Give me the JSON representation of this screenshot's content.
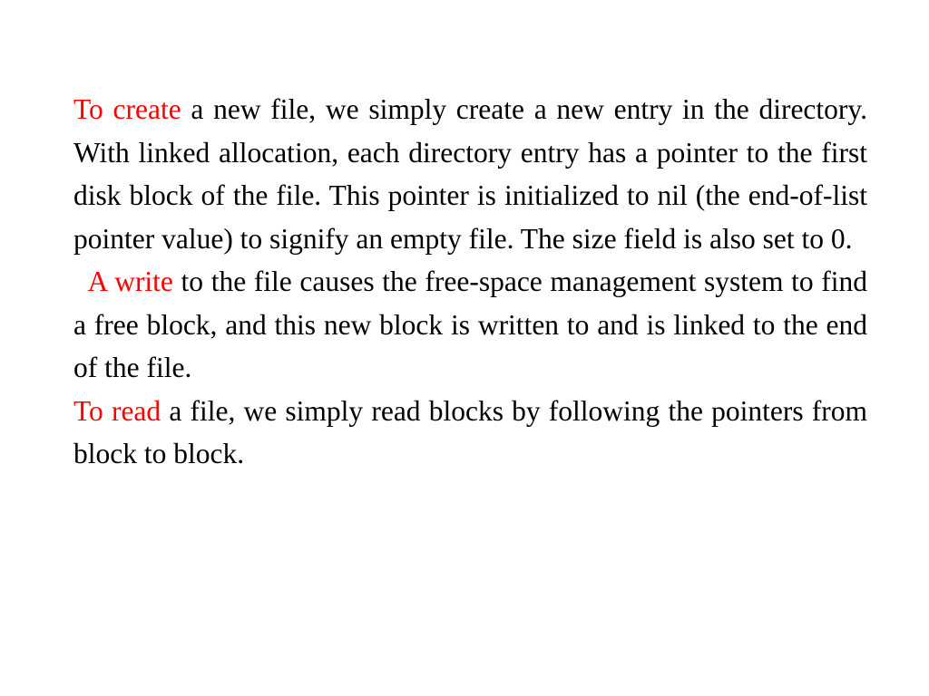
{
  "slide": {
    "background_color": "#ffffff",
    "text_color": "#000000",
    "accent_color": "#ff0000",
    "paragraphs": [
      {
        "id": "create",
        "accent": "To create",
        "rest": " a new file, we simply create a new entry in the directory. With linked allocation, each directory entry has a pointer to the first disk block of the file. This pointer is initialized to nil (the end-of-list pointer value) to signify an empty file. The size field is also set to 0."
      },
      {
        "id": "write",
        "accent": "A write",
        "rest": " to the file causes the free-space management system to find a free block, and this new block is written to and is linked to the end of the file."
      },
      {
        "id": "read",
        "accent": "To read",
        "rest": " a file, we simply read blocks by following the pointers from block to block."
      }
    ]
  }
}
